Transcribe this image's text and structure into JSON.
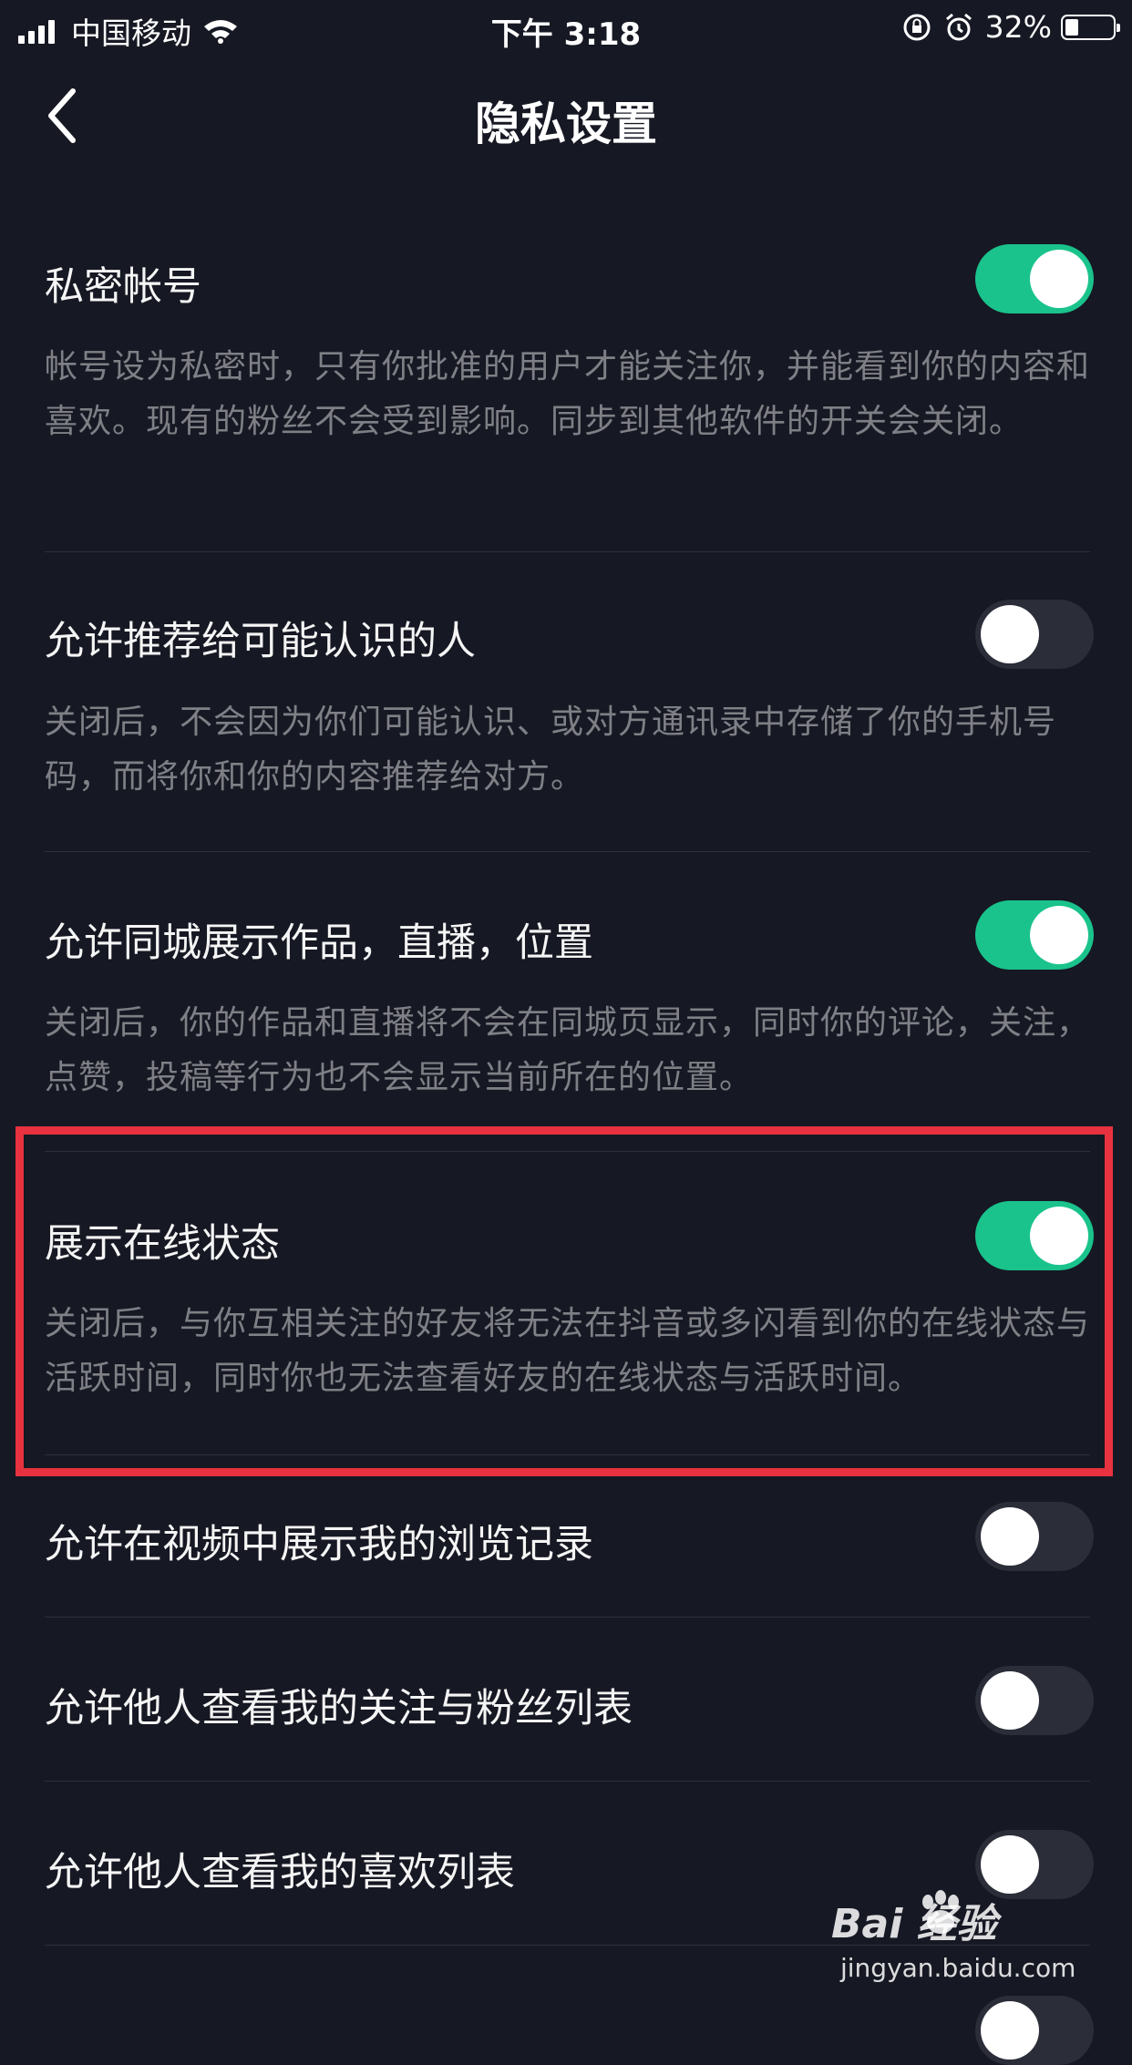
{
  "status_bar": {
    "carrier": "中国移动",
    "time": "下午 3:18",
    "battery": "32%"
  },
  "nav": {
    "title": "隐私设置"
  },
  "settings": [
    {
      "label": "私密帐号",
      "description": "帐号设为私密时，只有你批准的用户才能关注你，并能看到你的内容和喜欢。现有的粉丝不会受到影响。同步到其他软件的开关会关闭。",
      "enabled": true
    },
    {
      "label": "允许推荐给可能认识的人",
      "description": "关闭后，不会因为你们可能认识、或对方通讯录中存储了你的手机号码，而将你和你的内容推荐给对方。",
      "enabled": false
    },
    {
      "label": "允许同城展示作品，直播，位置",
      "description": "关闭后，你的作品和直播将不会在同城页显示，同时你的评论，关注，点赞，投稿等行为也不会显示当前所在的位置。",
      "enabled": true
    },
    {
      "label": "展示在线状态",
      "description": "关闭后，与你互相关注的好友将无法在抖音或多闪看到你的在线状态与活跃时间，同时你也无法查看好友的在线状态与活跃时间。",
      "enabled": true
    },
    {
      "label": "允许在视频中展示我的浏览记录",
      "enabled": false
    },
    {
      "label": "允许他人查看我的关注与粉丝列表",
      "enabled": false
    },
    {
      "label": "允许他人查看我的喜欢列表",
      "enabled": false
    }
  ],
  "watermark": {
    "logo": "Bai  经验",
    "url": "jingyan.baidu.com"
  },
  "colors": {
    "background": "#161823",
    "toggle_on": "#1ac38c",
    "toggle_off": "#2b2d38",
    "highlight": "#e8323f"
  }
}
